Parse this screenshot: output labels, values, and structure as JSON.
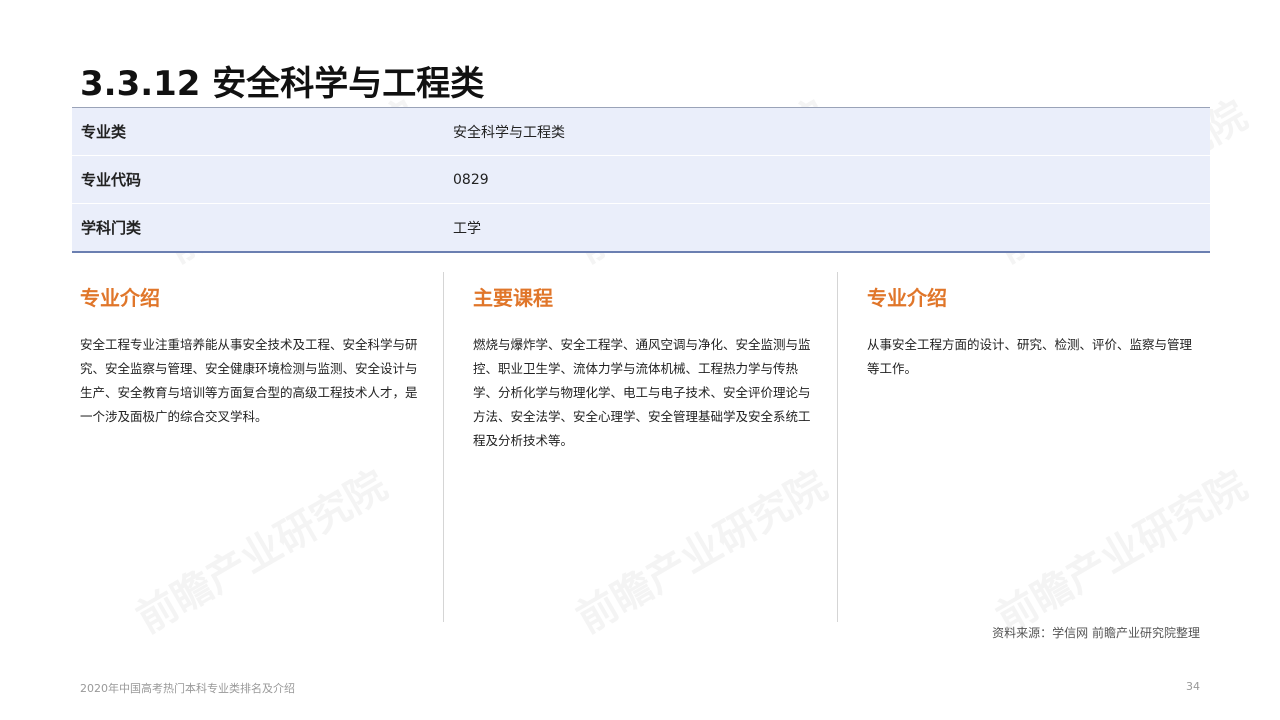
{
  "page": {
    "title": "3.3.12 安全科学与工程类"
  },
  "info_table": [
    {
      "key": "专业类",
      "value": "安全科学与工程类"
    },
    {
      "key": "专业代码",
      "value": "0829"
    },
    {
      "key": "学科门类",
      "value": "工学"
    }
  ],
  "columns": [
    {
      "heading": "专业介绍",
      "body": "安全工程专业注重培养能从事安全技术及工程、安全科学与研究、安全监察与管理、安全健康环境检测与监测、安全设计与生产、安全教育与培训等方面复合型的高级工程技术人才，是一个涉及面极广的综合交叉学科。"
    },
    {
      "heading": "主要课程",
      "body": "燃烧与爆炸学、安全工程学、通风空调与净化、安全监测与监控、职业卫生学、流体力学与流体机械、工程热力学与传热学、分析化学与物理化学、电工与电子技术、安全评价理论与方法、安全法学、安全心理学、安全管理基础学及安全系统工程及分析技术等。"
    },
    {
      "heading": "专业介绍",
      "body": "从事安全工程方面的设计、研究、检测、评价、监察与管理等工作。"
    }
  ],
  "source_note": "资料来源：学信网 前瞻产业研究院整理",
  "footer": {
    "report_name": "2020年中国高考热门本科专业类排名及介绍",
    "page_number": "34"
  },
  "watermark": {
    "text": "前瞻产业研究院"
  }
}
